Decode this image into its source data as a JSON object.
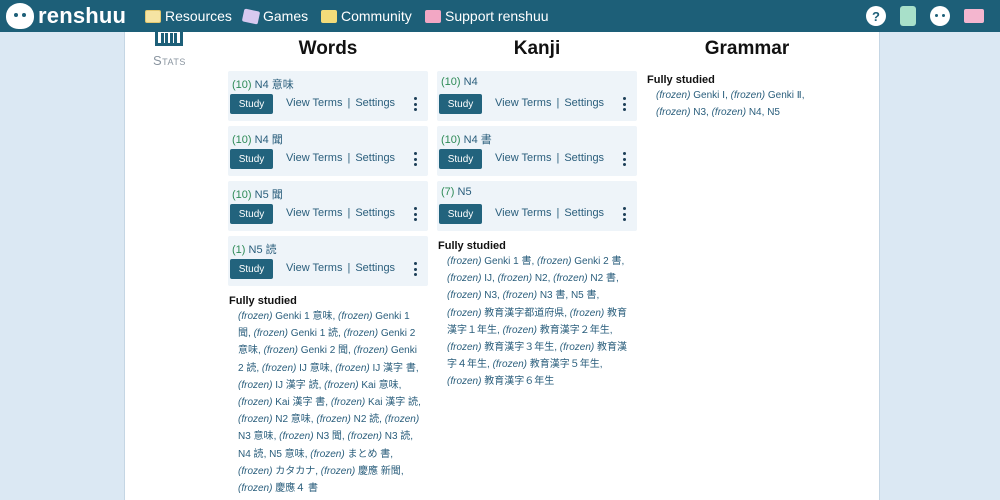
{
  "topbar": {
    "logo_text": "renshuu",
    "nav": [
      {
        "label": "Resources",
        "icon": "book-icon"
      },
      {
        "label": "Games",
        "icon": "dice-icon"
      },
      {
        "label": "Community",
        "icon": "chat-icon"
      },
      {
        "label": "Support renshuu",
        "icon": "heart-icon"
      }
    ],
    "right_icons": [
      "help-icon",
      "list-icon",
      "profile-icon",
      "mail-icon"
    ],
    "help_glyph": "?",
    "bg_color": "#1d5f78"
  },
  "stats": {
    "label": "Stats"
  },
  "columns": {
    "words": {
      "title": "Words",
      "cards": [
        {
          "count": "(10)",
          "name": "N4 意味"
        },
        {
          "count": "(10)",
          "name": "N4 聞"
        },
        {
          "count": "(10)",
          "name": "N5 聞"
        },
        {
          "count": "(1)",
          "name": "N5 読"
        }
      ],
      "fully_studied_title": "Fully studied",
      "fully_studied": [
        "Genki 1 意味",
        "Genki 1 聞",
        "Genki 1 読",
        "Genki 2 意味",
        "Genki 2 聞",
        "Genki 2 読",
        "IJ 意味",
        "IJ 漢字 書",
        "IJ 漢字 読",
        "Kai 意味",
        "Kai 漢字 書",
        "Kai 漢字 読",
        "N2 意味",
        "N2 読",
        "N3 意味",
        "N3 聞",
        "N3 読",
        "N4 読",
        "N5 意味",
        "まとめ 書",
        "カタカナ",
        "慶應 新聞",
        "慶應４ 書"
      ],
      "frozen_items": [
        true,
        true,
        true,
        true,
        true,
        true,
        true,
        true,
        true,
        true,
        true,
        true,
        true,
        true,
        true,
        true,
        true,
        false,
        false,
        true,
        true,
        true,
        true
      ]
    },
    "kanji": {
      "title": "Kanji",
      "cards": [
        {
          "count": "(10)",
          "name": "N4"
        },
        {
          "count": "(10)",
          "name": "N4 書"
        },
        {
          "count": "(7)",
          "name": "N5"
        }
      ],
      "fully_studied_title": "Fully studied",
      "fully_studied": [
        "Genki 1 書",
        "Genki 2 書",
        "IJ",
        "N2",
        "N2 書",
        "N3",
        "N3 書",
        "N5 書",
        "教育漢字都道府県",
        "教育漢字１年生",
        "教育漢字２年生",
        "教育漢字３年生",
        "教育漢字４年生",
        "教育漢字５年生",
        "教育漢字６年生"
      ],
      "frozen_items": [
        true,
        true,
        true,
        true,
        true,
        true,
        true,
        false,
        true,
        true,
        true,
        true,
        true,
        true,
        true
      ]
    },
    "grammar": {
      "title": "Grammar",
      "fully_studied_title": "Fully studied",
      "fully_studied": [
        "Genki Ⅰ",
        "Genki Ⅱ",
        "N3",
        "N4",
        "N5"
      ],
      "frozen_items": [
        true,
        true,
        true,
        true,
        false
      ]
    }
  },
  "card_labels": {
    "study": "Study",
    "view_terms": "View Terms",
    "settings": "Settings",
    "separator": "|"
  },
  "frozen_label": "(frozen)"
}
